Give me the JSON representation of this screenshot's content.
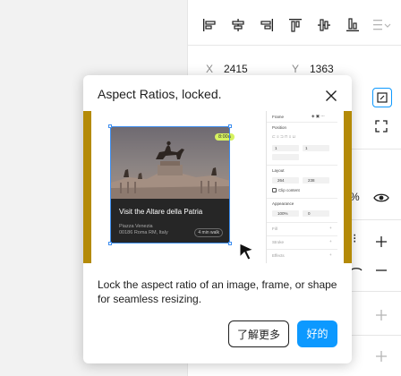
{
  "properties": {
    "x_label": "X",
    "x_value": "2415",
    "y_label": "Y",
    "y_value": "1363"
  },
  "dialog": {
    "title": "Aspect Ratios, locked.",
    "description": "Lock the aspect ratio of an image, frame, or shape for seamless resizing.",
    "learn_more_label": "了解更多",
    "ok_label": "好的"
  },
  "preview": {
    "card_title": "Visit the Altare della Patria",
    "card_address_1": "Piazza Venezia",
    "card_address_2": "00186 Roma RM, Italy",
    "card_walk": "4 min walk",
    "time_badge": "8:00a",
    "panel": {
      "frame_label": "Frame",
      "position_label": "Position",
      "x_val": "1",
      "y_val": "1",
      "layout_label": "Layout",
      "w_val": "264",
      "h_val": "238",
      "clip_label": "Clip content",
      "appearance_label": "Appearance",
      "opacity_val": "100%",
      "radius_val": "0",
      "fill_label": "Fill",
      "stroke_label": "Stroke",
      "effects_label": "Effects"
    }
  },
  "colors": {
    "accent": "#0d99ff",
    "preview_border": "#b48a07",
    "selection": "#3d8ef0",
    "badge": "#d6f25f"
  }
}
